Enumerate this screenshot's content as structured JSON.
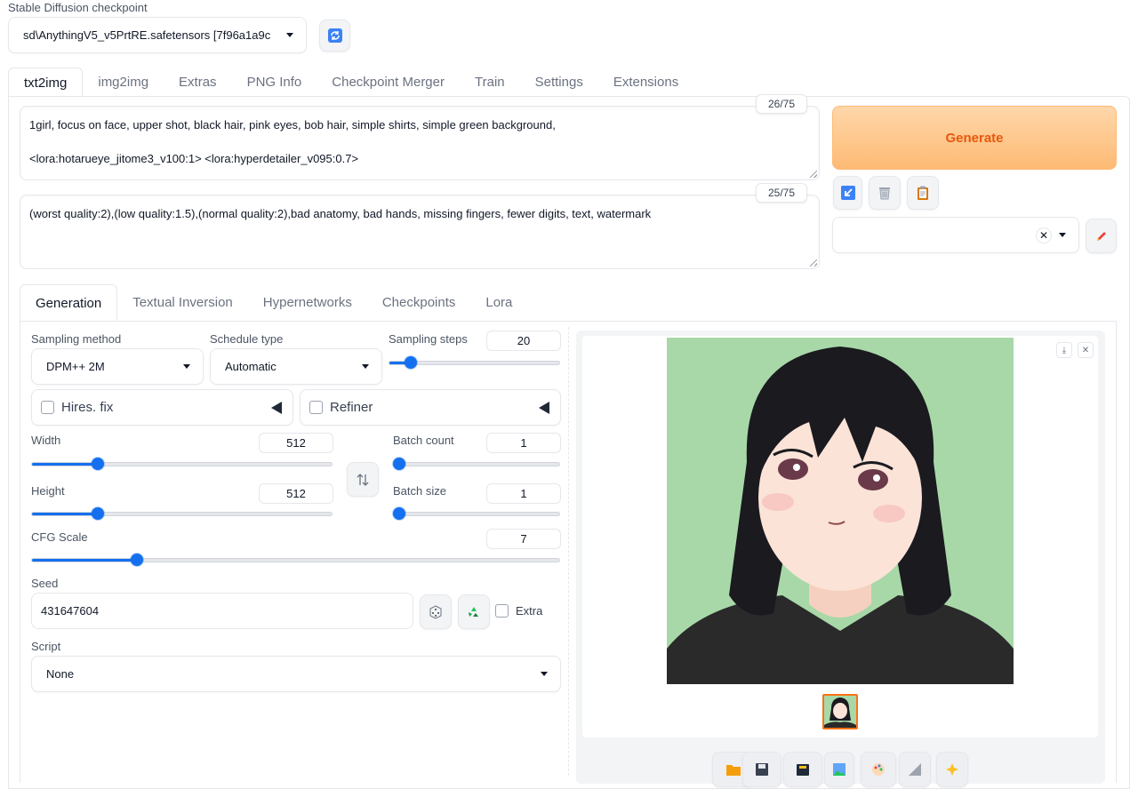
{
  "checkpoint": {
    "label": "Stable Diffusion checkpoint",
    "value": "sd\\AnythingV5_v5PrtRE.safetensors [7f96a1a9c"
  },
  "main_tabs": [
    "txt2img",
    "img2img",
    "Extras",
    "PNG Info",
    "Checkpoint Merger",
    "Train",
    "Settings",
    "Extensions"
  ],
  "prompt": {
    "line1": "1girl, focus on face, upper shot, black hair, pink eyes, bob hair, simple shirts, simple green background,",
    "line2": "<lora:hotarueye_jitome3_v100:1> <lora:hyperdetailer_v095:0.7>",
    "token_count": "26/75"
  },
  "negative_prompt": {
    "text": "(worst quality:2),(low quality:1.5),(normal quality:2),bad anatomy, bad hands, missing fingers, fewer digits, text, watermark",
    "token_count": "25/75"
  },
  "generate_label": "Generate",
  "sub_tabs": [
    "Generation",
    "Textual Inversion",
    "Hypernetworks",
    "Checkpoints",
    "Lora"
  ],
  "sampling": {
    "method_label": "Sampling method",
    "method_value": "DPM++ 2M",
    "schedule_label": "Schedule type",
    "schedule_value": "Automatic",
    "steps_label": "Sampling steps",
    "steps_value": "20",
    "steps_fraction": 0.13
  },
  "hires_label": "Hires. fix",
  "refiner_label": "Refiner",
  "width": {
    "label": "Width",
    "value": "512",
    "fraction": 0.22
  },
  "height": {
    "label": "Height",
    "value": "512",
    "fraction": 0.22
  },
  "batch_count": {
    "label": "Batch count",
    "value": "1",
    "fraction": 0.0
  },
  "batch_size": {
    "label": "Batch size",
    "value": "1",
    "fraction": 0.0
  },
  "cfg": {
    "label": "CFG Scale",
    "value": "7",
    "fraction": 0.2
  },
  "seed": {
    "label": "Seed",
    "value": "431647604",
    "extra_label": "Extra"
  },
  "script": {
    "label": "Script",
    "value": "None"
  },
  "colors": {
    "accent": "#1570ef",
    "generate_bg": "#fdba74",
    "generate_text": "#ea580c",
    "image_bg": "#a8d8a8",
    "hair": "#1a1a1f",
    "shirt": "#2a2a2a",
    "skin": "#fbe3d8"
  },
  "icons": {
    "refresh": "refresh-icon",
    "paste": "arrow-icon",
    "trash": "trash-icon",
    "clipboard": "clipboard-icon",
    "edit": "pencil-icon",
    "dice": "dice-icon",
    "recycle": "recycle-icon",
    "swap": "swap-icon",
    "download": "download-icon",
    "close": "close-icon",
    "toolbar": [
      "folder-icon",
      "save-icon",
      "zip-icon",
      "image-icon",
      "palette-icon",
      "ruler-icon",
      "sparkle-icon"
    ]
  }
}
